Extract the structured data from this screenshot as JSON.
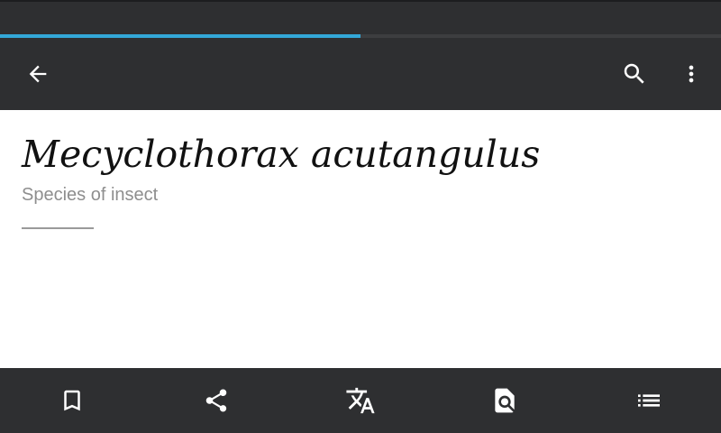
{
  "status_bar": {},
  "page_load_progress": 0.5,
  "toolbar": {
    "back_icon": "arrow-back-icon",
    "search_icon": "search-icon",
    "overflow_icon": "more-vert-icon"
  },
  "article": {
    "title": "Mecyclothorax acutangulus",
    "description": "Species of insect"
  },
  "bottom_bar": {
    "items": [
      {
        "icon": "bookmark-icon"
      },
      {
        "icon": "share-icon"
      },
      {
        "icon": "translate-icon"
      },
      {
        "icon": "find-in-page-icon"
      },
      {
        "icon": "table-of-contents-icon"
      }
    ]
  },
  "colors": {
    "bar_background": "#2e2f31",
    "progress_accent": "#33a8d8",
    "icon_color": "#ffffff",
    "subtitle_color": "#8e8e8e"
  }
}
